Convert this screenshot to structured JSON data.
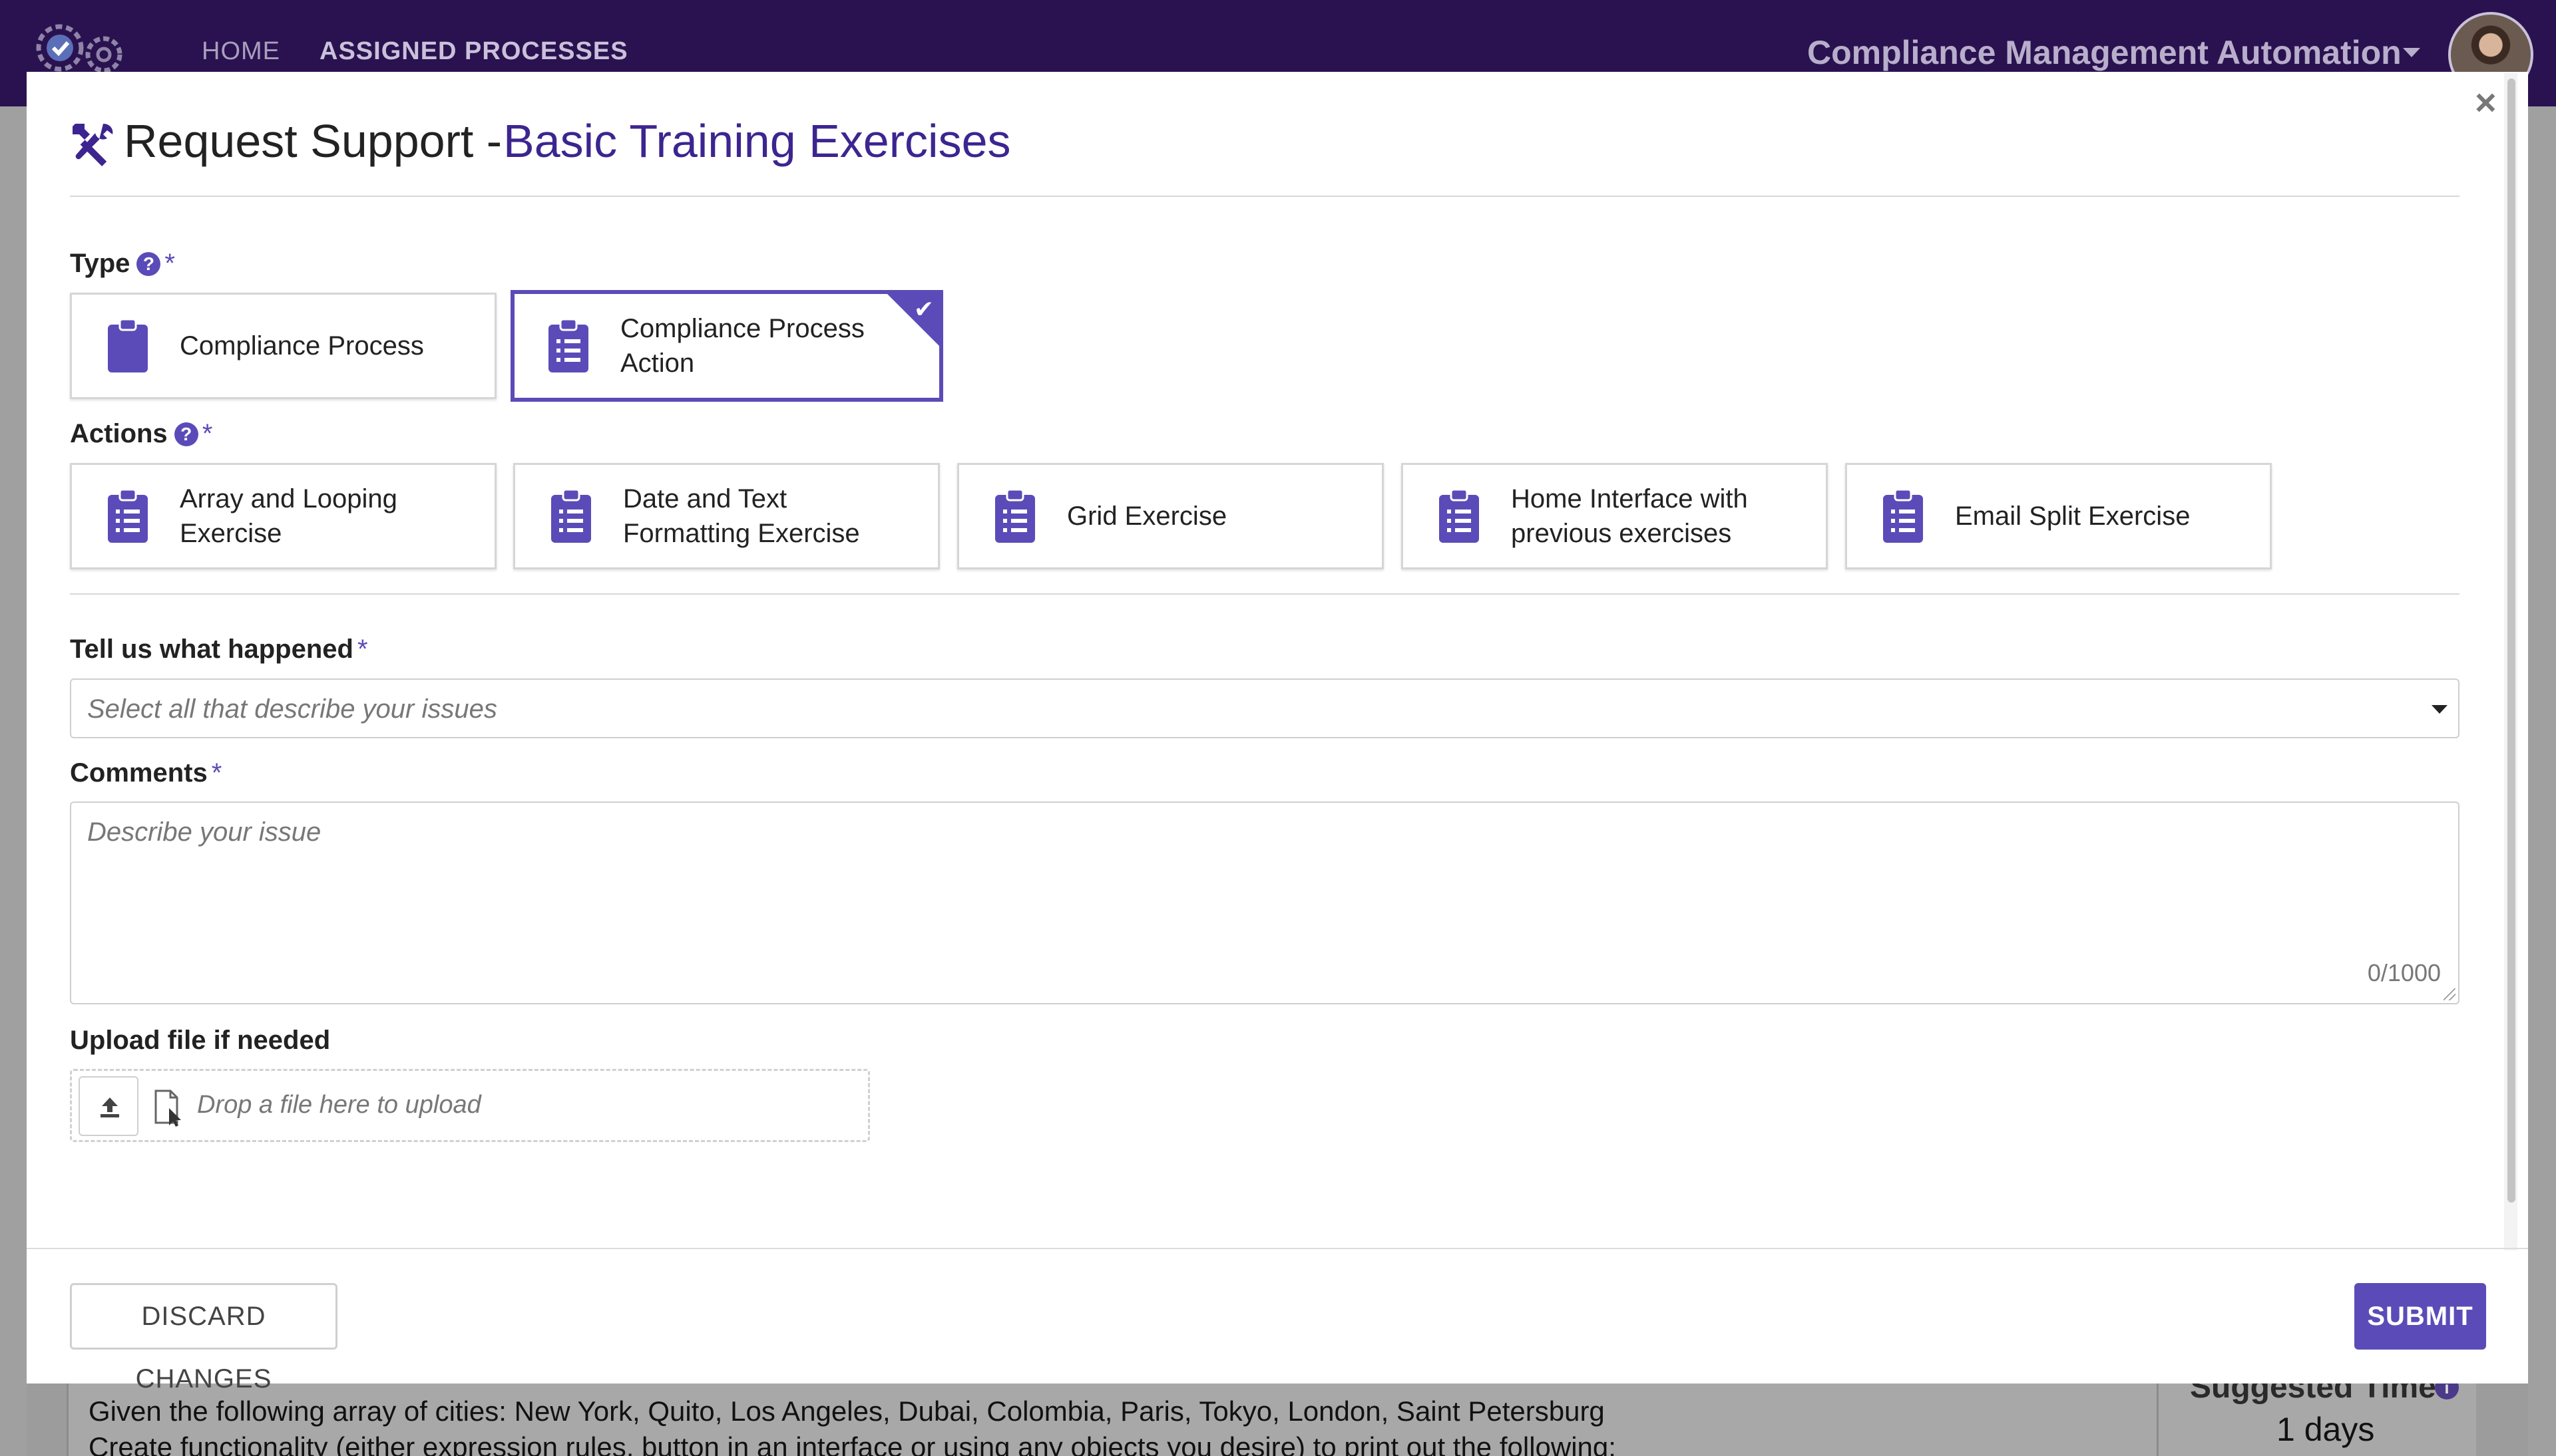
{
  "header": {
    "nav": {
      "home": "HOME",
      "assigned": "ASSIGNED PROCESSES"
    },
    "app_name": "Compliance Management Automation"
  },
  "background": {
    "line1": "Given the following array of cities: New York, Quito, Los Angeles, Dubai, Colombia, Paris, Tokyo, London, Saint Petersburg",
    "line2": "Create functionality (either expression rules, button in an interface or using any objects you desire) to print out the following:",
    "suggested_label": "Suggested Time",
    "suggested_value": "1 days"
  },
  "modal": {
    "close": "×",
    "title_prefix": "Request Support -",
    "title_name": "Basic Training Exercises",
    "type_label": "Type",
    "type_options": [
      {
        "label": "Compliance Process",
        "icon": "clipboard-icon",
        "selected": false
      },
      {
        "label": "Compliance Process Action",
        "icon": "clipboard-list-icon",
        "selected": true
      }
    ],
    "actions_label": "Actions",
    "actions": [
      {
        "label": "Array and Looping Exercise",
        "icon": "clipboard-list-icon"
      },
      {
        "label": "Date and Text Formatting Exercise",
        "icon": "clipboard-list-icon"
      },
      {
        "label": "Grid Exercise",
        "icon": "clipboard-list-icon"
      },
      {
        "label": "Home Interface with previous exercises",
        "icon": "clipboard-list-icon"
      },
      {
        "label": "Email Split Exercise",
        "icon": "clipboard-list-icon"
      }
    ],
    "happened_label": "Tell us what happened",
    "happened_placeholder": "Select all that describe your issues",
    "comments_label": "Comments",
    "comments_placeholder": "Describe your issue",
    "comments_counter": "0/1000",
    "upload_label": "Upload file if needed",
    "upload_placeholder": "Drop a file here to upload",
    "required_mark": "*",
    "help_mark": "?",
    "discard_label": "DISCARD CHANGES",
    "submit_label": "SUBMIT"
  },
  "colors": {
    "brand_dark": "#2a1250",
    "accent": "#5b4bb8",
    "title_accent": "#3d2590"
  }
}
